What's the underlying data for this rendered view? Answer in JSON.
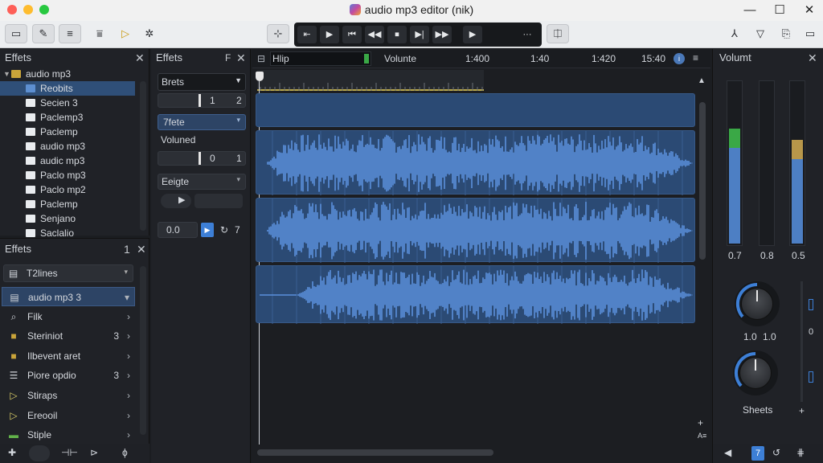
{
  "window": {
    "title": "audio mp3 editor (nik)"
  },
  "toolbar": {
    "left_icons": [
      "open-folder-icon",
      "brush-icon",
      "list-icon",
      "filter-icon",
      "play-marker-icon",
      "gear-icon"
    ],
    "right_icons": [
      "split-icon",
      "down-triangle-icon",
      "clipboard-icon",
      "window-icon"
    ]
  },
  "transport": {
    "buttons": [
      "rewind",
      "play",
      "skip-back",
      "step-back",
      "stop",
      "step-forward",
      "fast-forward",
      "play"
    ],
    "more": "···"
  },
  "files_panel": {
    "title": "Effets",
    "root": "audio mp3",
    "items": [
      {
        "label": "Reobits",
        "selected": true
      },
      {
        "label": "Secien 3",
        "selected": false
      },
      {
        "label": "Paclemp3",
        "selected": false
      },
      {
        "label": "Paclemp",
        "selected": false
      },
      {
        "label": "audio mp3",
        "selected": false
      },
      {
        "label": "audic mp3",
        "selected": false
      },
      {
        "label": "Paclo mp3",
        "selected": false
      },
      {
        "label": "Paclo mp2",
        "selected": false
      },
      {
        "label": "Paclemp",
        "selected": false
      },
      {
        "label": "Senjano",
        "selected": false
      },
      {
        "label": "Saclalio",
        "selected": false
      }
    ]
  },
  "effects_list": {
    "title": "Effets",
    "count": "1",
    "header": "T2lines",
    "items": [
      {
        "label": "audio mp3 3",
        "count": "",
        "icon": "file-icon",
        "selected": true
      },
      {
        "label": "Filk",
        "count": "",
        "icon": "search-icon",
        "selected": false
      },
      {
        "label": "Steriniot",
        "count": "3",
        "icon": "folder-icon",
        "selected": false
      },
      {
        "label": "Ilbevent aret",
        "count": "",
        "icon": "folder-icon",
        "selected": false
      },
      {
        "label": "Piore opdio",
        "count": "3",
        "icon": "list-icon",
        "selected": false
      },
      {
        "label": "Stiraps",
        "count": "",
        "icon": "play-outline-icon",
        "selected": false
      },
      {
        "label": "Ereooil",
        "count": "",
        "icon": "play-outline-icon",
        "selected": false
      },
      {
        "label": "Stiple",
        "count": "",
        "icon": "green-bar-icon",
        "selected": false
      }
    ]
  },
  "effects_panel": {
    "title": "Effets",
    "dropdown": "Brets",
    "slider1": {
      "left": "1",
      "right": "2"
    },
    "selected": "7fete",
    "volume_label": "Voluned",
    "slider2": {
      "left": "0",
      "right": "1"
    },
    "eq_label": "Eeigte",
    "value_field": "0.0",
    "value_right": "7"
  },
  "timeline": {
    "search_text": "Hlip",
    "labels": [
      "Volunte",
      "1:400",
      "1:40",
      "1:420",
      "15:40"
    ]
  },
  "tracks": [
    {
      "type": "empty"
    },
    {
      "type": "wave"
    },
    {
      "type": "wave"
    },
    {
      "type": "wave"
    }
  ],
  "mixer": {
    "title": "Volumt",
    "meters": [
      {
        "level": 0.59,
        "peak_color": "#3aa846"
      },
      {
        "level": 0,
        "peak_color": ""
      },
      {
        "level": 0.52,
        "peak_color": "#b8974a"
      }
    ],
    "meter_labels": [
      "0.7",
      "0.8",
      "0.5"
    ],
    "knob1_labels": [
      "1.0",
      "1.0"
    ],
    "knob2_label": "Sheets"
  },
  "colors": {
    "accent": "#3d7fd6",
    "track": "#2b4a74",
    "wave": "#5b90dc"
  }
}
